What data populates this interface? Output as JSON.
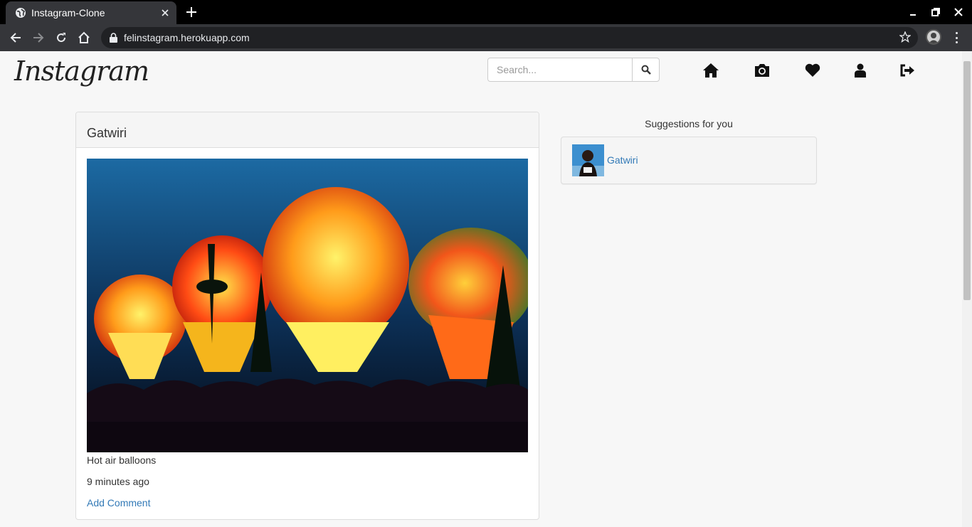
{
  "browser": {
    "tab_title": "Instagram-Clone",
    "url": "felinstagram.herokuapp.com"
  },
  "header": {
    "logo_text": "Instagram",
    "search_placeholder": "Search...",
    "nav_icons": [
      "home-icon",
      "camera-icon",
      "heart-icon",
      "user-icon",
      "logout-icon"
    ]
  },
  "post": {
    "author": "Gatwiri",
    "caption": "Hot air balloons",
    "time": "9 minutes ago",
    "add_comment_label": "Add Comment"
  },
  "suggestions": {
    "title": "Suggestions for you",
    "items": [
      {
        "name": "Gatwiri"
      }
    ]
  },
  "colors": {
    "link": "#337ab7",
    "chrome_dark": "#35363a",
    "page_bg": "#f7f7f7"
  }
}
